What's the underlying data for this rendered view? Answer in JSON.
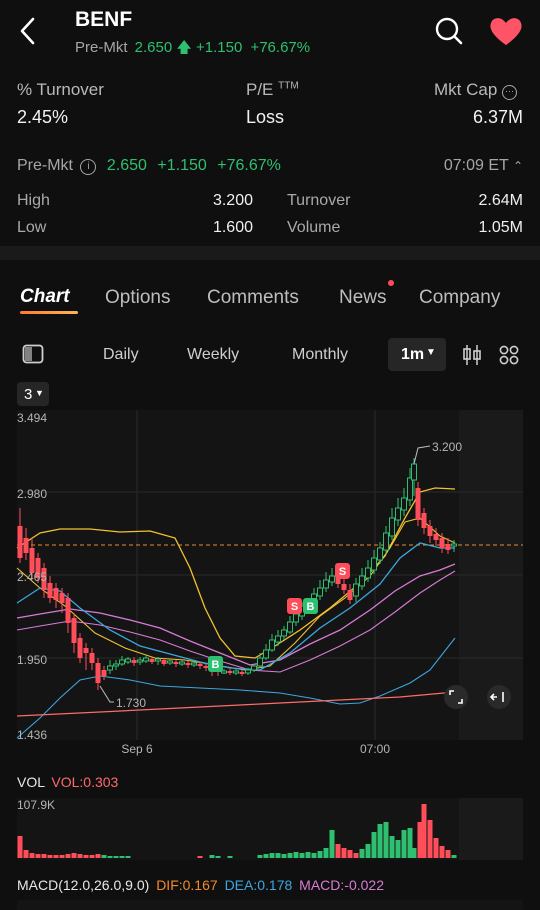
{
  "header": {
    "ticker": "BENF",
    "premkt_label": "Pre-Mkt",
    "premkt_price": "2.650",
    "premkt_change": "+1.150",
    "premkt_pct": "+76.67%"
  },
  "stats": {
    "turnover_pct_label": "% Turnover",
    "turnover_pct": "2.45%",
    "pe_label": "P/E",
    "pe_sup": "TTM",
    "pe_value": "Loss",
    "mktcap_label": "Mkt Cap",
    "mktcap_value": "6.37M"
  },
  "premarket": {
    "label": "Pre-Mkt",
    "price": "2.650",
    "change": "+1.150",
    "pct": "+76.67%",
    "time": "07:09 ET",
    "high_label": "High",
    "high": "3.200",
    "low_label": "Low",
    "low": "1.600",
    "turnover_label": "Turnover",
    "turnover": "2.64M",
    "volume_label": "Volume",
    "volume": "1.05M"
  },
  "tabs": [
    {
      "label": "Chart"
    },
    {
      "label": "Options"
    },
    {
      "label": "Comments"
    },
    {
      "label": "News"
    },
    {
      "label": "Company"
    }
  ],
  "periods": {
    "daily": "Daily",
    "weekly": "Weekly",
    "monthly": "Monthly",
    "selected": "1m"
  },
  "indicator_select": "3",
  "chart_labels": {
    "y_top": "3.494",
    "y_2": "2.980",
    "y_3": "2.465",
    "y_4": "1.950",
    "y_bottom": "1.436",
    "high_marker": "3.200",
    "low_marker": "1.730",
    "x_1": "Sep 6",
    "x_2": "07:00"
  },
  "vol": {
    "label": "VOL",
    "value_label": "VOL:0.303",
    "axis_max": "107.9K"
  },
  "macd": {
    "label": "MACD(12.0,26.0,9.0)",
    "dif": "DIF:0.167",
    "dea": "DEA:0.178",
    "macd": "MACD:-0.022"
  },
  "colors": {
    "up": "#2fbf71",
    "down": "#ff4d5a",
    "bg": "#0f0f0f",
    "chart_bg": "#141414",
    "heart": "#ff5468",
    "ma_yellow": "#f2c230",
    "ma_blue": "#3da6e0",
    "ma_pink": "#d77bd6",
    "ma_red": "#ff6b6b"
  }
}
